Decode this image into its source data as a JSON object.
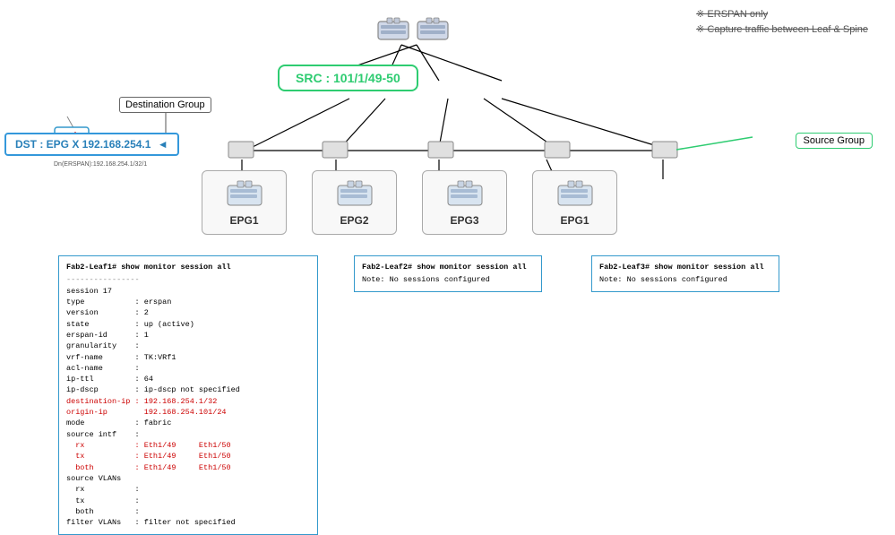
{
  "erspan_note": {
    "line1": "※ ERSPAN only",
    "line2": "※ Capture traffic between Leaf & Spine"
  },
  "src_box": {
    "label": "SRC : 101/1/49-50"
  },
  "source_group": {
    "label": "Source Group"
  },
  "dest_group": {
    "label": "Destination Group"
  },
  "dst_box": {
    "label": "DST : EPG X 192.168.254.1"
  },
  "analyzer_label": "Dn(ERSPAN):192.168.254.1/32/1",
  "epgs": [
    {
      "label": "EPG1"
    },
    {
      "label": "EPG2"
    },
    {
      "label": "EPG3"
    },
    {
      "label": "EPG1"
    }
  ],
  "terminal1": {
    "title": "Fab2-Leaf1# show monitor session all",
    "separator": "----------------",
    "lines": [
      {
        "key": "session 17",
        "value": ""
      },
      {
        "key": "type",
        "value": ": erspan"
      },
      {
        "key": "version",
        "value": ": 2"
      },
      {
        "key": "state",
        "value": ": up (active)"
      },
      {
        "key": "erspan-id",
        "value": ": 1"
      },
      {
        "key": "granularity",
        "value": ":"
      },
      {
        "key": "vrf-name",
        "value": ": TK:VRf1"
      },
      {
        "key": "acl-name",
        "value": ":"
      },
      {
        "key": "ip-ttl",
        "value": ": 64"
      },
      {
        "key": "ip-dscp",
        "value": ": ip-dscp not specified"
      },
      {
        "key": "destination-ip",
        "value": ": 192.168.254.1/32",
        "red": true
      },
      {
        "key": "origin-ip",
        "value": "  192.168.254.101/24",
        "red": true
      },
      {
        "key": "mode",
        "value": ": fabric"
      },
      {
        "key": "source intf",
        "value": ":"
      },
      {
        "key": "  rx",
        "value": ": Eth1/49     Eth1/50"
      },
      {
        "key": "  tx",
        "value": ": Eth1/49     Eth1/50"
      },
      {
        "key": "  both",
        "value": ": Eth1/49     Eth1/50"
      },
      {
        "key": "source VLANs",
        "value": ""
      },
      {
        "key": "  rx",
        "value": ":"
      },
      {
        "key": "  tx",
        "value": ":"
      },
      {
        "key": "  both",
        "value": ":"
      },
      {
        "key": "filter VLANs",
        "value": ": filter not specified"
      }
    ]
  },
  "terminal2": {
    "title": "Fab2-Leaf2# show monitor session all",
    "note": "Note: No sessions configured"
  },
  "terminal3": {
    "title": "Fab2-Leaf3# show monitor session all",
    "note": "Note: No sessions configured"
  }
}
